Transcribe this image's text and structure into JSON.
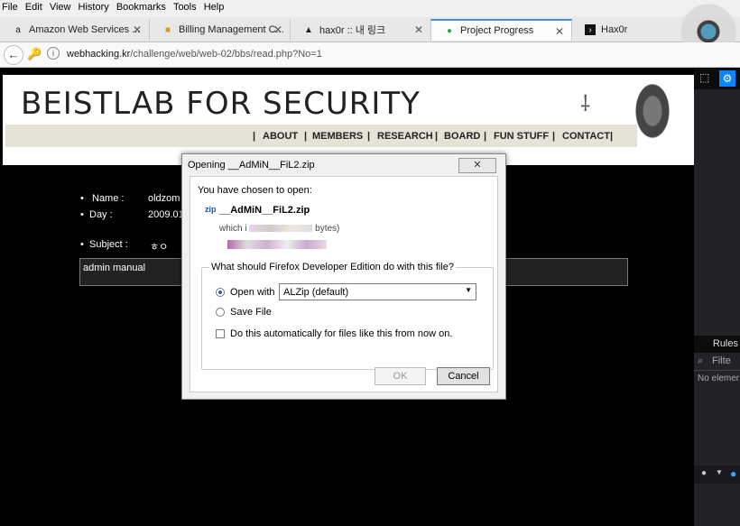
{
  "menu": [
    "File",
    "Edit",
    "View",
    "History",
    "Bookmarks",
    "Tools",
    "Help"
  ],
  "tabs": [
    {
      "label": "Amazon Web Services ...",
      "icon": "amazon-icon",
      "close": "✕"
    },
    {
      "label": "Billing Management C...",
      "icon": "package-icon",
      "close": "✕"
    },
    {
      "label": "hax0r :: 내 링크",
      "icon": "triangle-icon",
      "close": "✕"
    },
    {
      "label": "Project Progress",
      "icon": "green-shield-icon",
      "close": "✕"
    },
    {
      "label": "Hax0r",
      "icon": "terminal-icon"
    }
  ],
  "nav": {
    "url_host": "webhacking.kr",
    "url_path": "/challenge/web/web-02/bbs/read.php?No=1"
  },
  "site": {
    "title": "BEISTLAB FOR SECURITY",
    "nav_items": [
      "|",
      "ABOUT",
      "|",
      "MEMBERS",
      "|",
      "RESEARCH",
      "|",
      "BOARD",
      "|",
      "FUN STUFF",
      "|",
      "CONTACT",
      "|"
    ]
  },
  "post": {
    "name_label": "Name :",
    "name_value": "oldzom",
    "day_label": "Day :",
    "day_value": "2009.01.",
    "subject_label": "Subject :",
    "subject_value": "ㅎㅇ",
    "content": "admin manual",
    "bullet": "•"
  },
  "devtools": {
    "rules_label": "Rules",
    "filter_placeholder": "Filte",
    "no_element": "No elemer"
  },
  "dialog": {
    "title": "Opening __AdMiN__FiL2.zip",
    "close_label": "✕",
    "chosen_text": "You have chosen to open:",
    "file_name": "__AdMiN__FiL2.zip",
    "which_prefix": "which i",
    "which_suffix": "bytes)",
    "group_label": "What should Firefox Developer Edition do with this file?",
    "open_with_label": "Open with",
    "open_with_value": "ALZip (default)",
    "save_file_label": "Save File",
    "auto_label": "Do this automatically for files like this from now on.",
    "ok_label": "OK",
    "cancel_label": "Cancel"
  }
}
